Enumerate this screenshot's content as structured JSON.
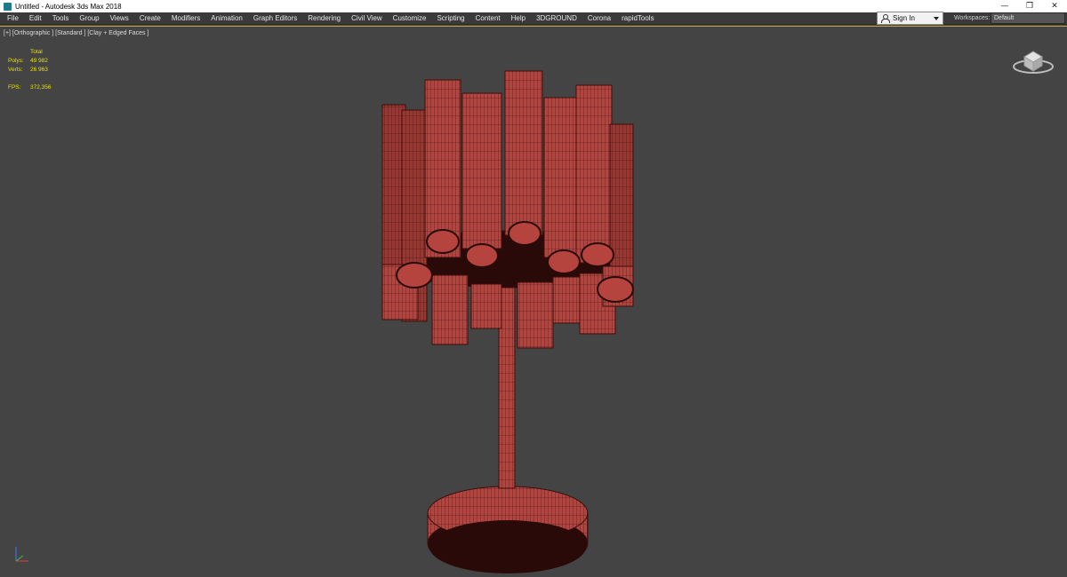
{
  "window": {
    "title": "Untitled - Autodesk 3ds Max 2018",
    "controls": {
      "minimize": "—",
      "restore": "❐",
      "close": "✕"
    }
  },
  "menubar": {
    "items": [
      "File",
      "Edit",
      "Tools",
      "Group",
      "Views",
      "Create",
      "Modifiers",
      "Animation",
      "Graph Editors",
      "Rendering",
      "Civil View",
      "Customize",
      "Scripting",
      "Content",
      "Help",
      "3DGROUND",
      "Corona",
      "rapidTools"
    ],
    "sign_in": "Sign In",
    "workspaces_label": "Workspaces:",
    "workspaces_value": "Default"
  },
  "viewport": {
    "label": "[+] [Orthographic ] [Standard ] [Clay + Edged Faces ]",
    "stats": {
      "total_label": "Total",
      "polys_label": "Polys:",
      "polys_value": "49 982",
      "verts_label": "Verts:",
      "verts_value": "26 963",
      "fps_label": "FPS:",
      "fps_value": "372,356"
    },
    "model_color": "#b5433e",
    "model_dark": "#2a0a08",
    "background": "#444444"
  }
}
